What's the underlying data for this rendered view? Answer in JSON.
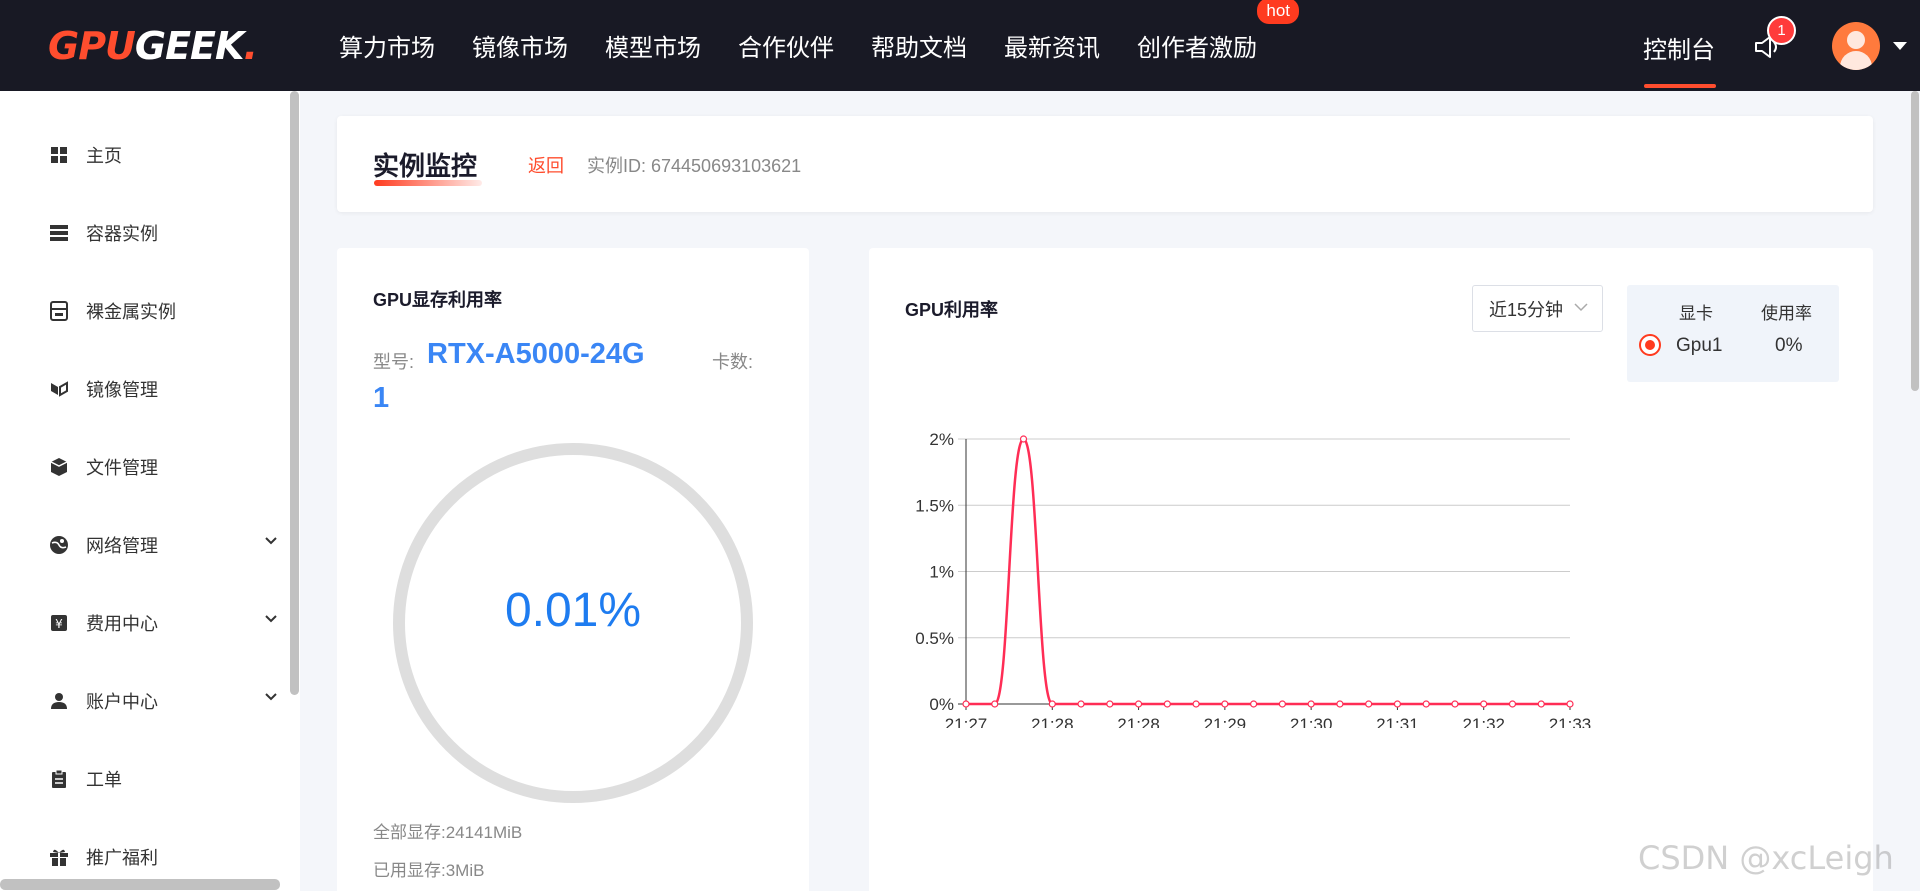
{
  "brand": {
    "part1": "GPU",
    "part2": "GEEK",
    "dot": "."
  },
  "nav": {
    "items": [
      "算力市场",
      "镜像市场",
      "模型市场",
      "合作伙伴",
      "帮助文档",
      "最新资讯",
      "创作者激励"
    ],
    "hot_badge": "hot",
    "console": "控制台",
    "notification_count": "1"
  },
  "sidebar": {
    "items": [
      {
        "label": "主页",
        "icon": "grid-icon"
      },
      {
        "label": "容器实例",
        "icon": "server-icon"
      },
      {
        "label": "裸金属实例",
        "icon": "machine-icon"
      },
      {
        "label": "镜像管理",
        "icon": "image-icon"
      },
      {
        "label": "文件管理",
        "icon": "box-icon"
      },
      {
        "label": "网络管理",
        "icon": "network-icon",
        "expandable": true
      },
      {
        "label": "费用中心",
        "icon": "yen-icon",
        "expandable": true
      },
      {
        "label": "账户中心",
        "icon": "user-icon",
        "expandable": true
      },
      {
        "label": "工单",
        "icon": "clipboard-icon"
      },
      {
        "label": "推广福利",
        "icon": "gift-icon"
      }
    ]
  },
  "header": {
    "title": "实例监控",
    "back": "返回",
    "instance_id": "实例ID: 674450693103621"
  },
  "memory": {
    "title": "GPU显存利用率",
    "model_label": "型号:",
    "model_value": "RTX-A5000-24G",
    "cards_label": "卡数:",
    "cards_value": "1",
    "usage_percent": "0.01%",
    "total": "全部显存:24141MiB",
    "used": "已用显存:3MiB"
  },
  "utilization": {
    "title": "GPU利用率",
    "range": "近15分钟",
    "legend": {
      "col_card": "显卡",
      "col_rate": "使用率",
      "gpu_name": "Gpu1",
      "gpu_rate": "0%"
    }
  },
  "chart_data": {
    "type": "line",
    "series": [
      {
        "name": "Gpu1",
        "color": "#ff2d55",
        "values": [
          0,
          0,
          2,
          0,
          0,
          0,
          0,
          0,
          0,
          0,
          0,
          0,
          0,
          0,
          0,
          0,
          0,
          0,
          0,
          0,
          0,
          0
        ]
      }
    ],
    "y_ticks": [
      "0%",
      "0.5%",
      "1%",
      "1.5%",
      "2%"
    ],
    "ylim": [
      0,
      2
    ],
    "x_tick_labels": [
      "21:27",
      "21:28",
      "21:28",
      "21:29",
      "21:30",
      "21:31",
      "21:32",
      "21:33"
    ],
    "grid": true
  },
  "watermark": "CSDN @xcLeigh"
}
